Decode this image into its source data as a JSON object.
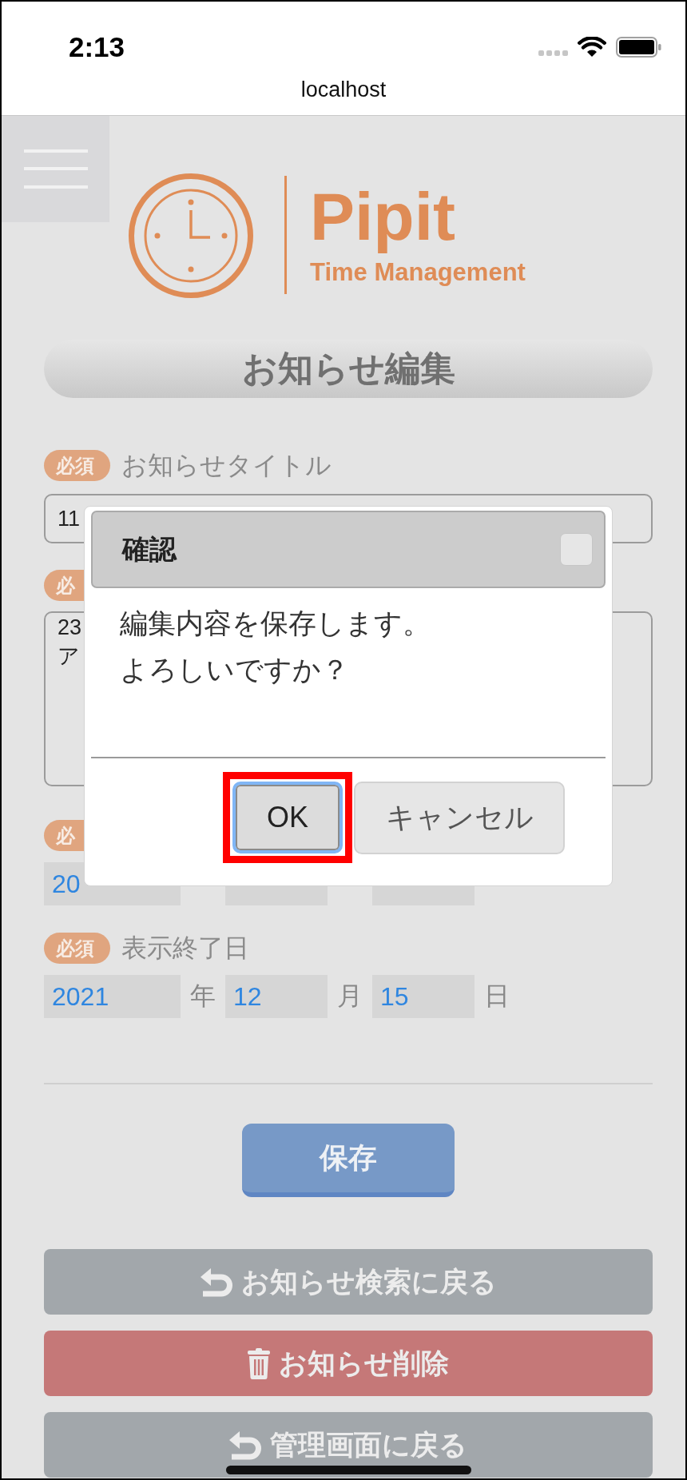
{
  "status_bar": {
    "time": "2:13"
  },
  "browser": {
    "url": "localhost"
  },
  "logo": {
    "name": "Pipit",
    "tagline": "Time Management"
  },
  "page_title": "お知らせ編集",
  "form": {
    "fields": [
      {
        "kind": "text",
        "badge": "必須",
        "label": "お知らせタイトル",
        "value": "11"
      },
      {
        "kind": "textarea",
        "badge": "必",
        "value": "23\nア"
      },
      {
        "kind": "date",
        "badge": "必",
        "year": "20"
      },
      {
        "kind": "date",
        "badge": "必須",
        "label": "表示終了日",
        "year": "2021",
        "year_unit": "年",
        "month": "12",
        "month_unit": "月",
        "day": "15",
        "day_unit": "日"
      }
    ]
  },
  "save_button": "保存",
  "nav_buttons": [
    {
      "kind": "back",
      "label": "お知らせ検索に戻る"
    },
    {
      "kind": "delete",
      "label": "お知らせ削除"
    },
    {
      "kind": "back",
      "label": "管理画面に戻る"
    }
  ],
  "dialog": {
    "title": "確認",
    "message_lines": [
      "編集内容を保存します。",
      "よろしいですか？"
    ],
    "buttons": [
      {
        "label": "OK",
        "highlighted": true,
        "focused": true
      },
      {
        "label": "キャンセル",
        "highlighted": false,
        "focused": false
      }
    ]
  }
}
